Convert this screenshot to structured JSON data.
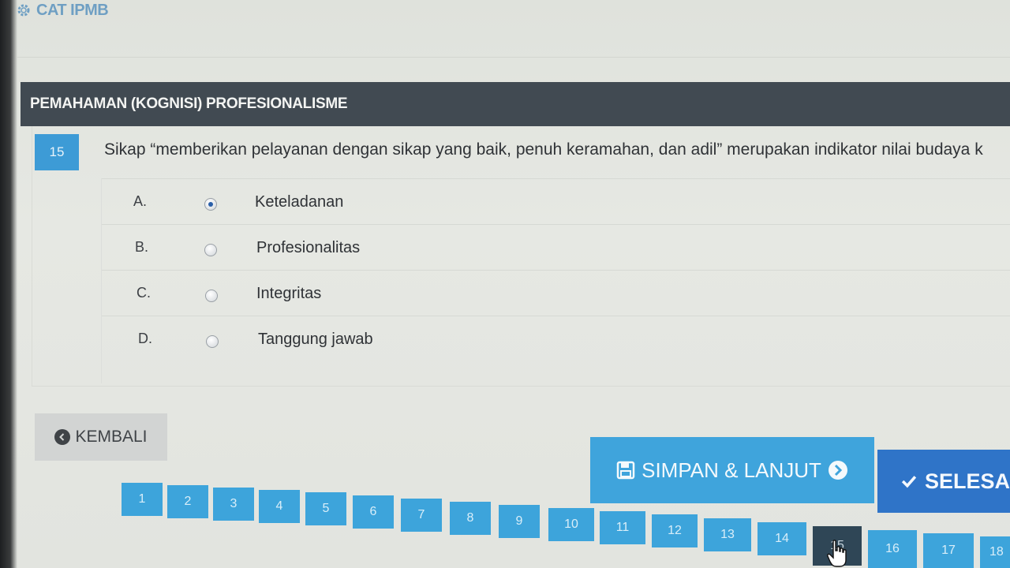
{
  "app": {
    "brand": "CAT IPMB",
    "brand_color": "#6f9fc3"
  },
  "section": {
    "title": "PEMAHAMAN (KOGNISI) PROFESIONALISME"
  },
  "question": {
    "number": "15",
    "text": "Sikap “memberikan pelayanan dengan sikap yang baik, penuh keramahan, dan adil” merupakan indikator nilai budaya k"
  },
  "options": [
    {
      "letter": "A.",
      "label": "Keteladanan",
      "checked": true
    },
    {
      "letter": "B.",
      "label": "Profesionalitas",
      "checked": false
    },
    {
      "letter": "C.",
      "label": "Integritas",
      "checked": false
    },
    {
      "letter": "D.",
      "label": "Tanggung jawab",
      "checked": false
    }
  ],
  "buttons": {
    "back": "KEMBALI",
    "save": "SIMPAN & LANJUT",
    "finish": "SELESA"
  },
  "pagination": {
    "pages": [
      "1",
      "2",
      "3",
      "4",
      "5",
      "6",
      "7",
      "8",
      "9",
      "10",
      "11",
      "12",
      "13",
      "14",
      "15",
      "16",
      "17",
      "18"
    ],
    "current": "15"
  },
  "colors": {
    "header_bar": "#414a52",
    "primary": "#3da4db",
    "finish": "#2f74c8",
    "active_page": "#2f4656"
  }
}
